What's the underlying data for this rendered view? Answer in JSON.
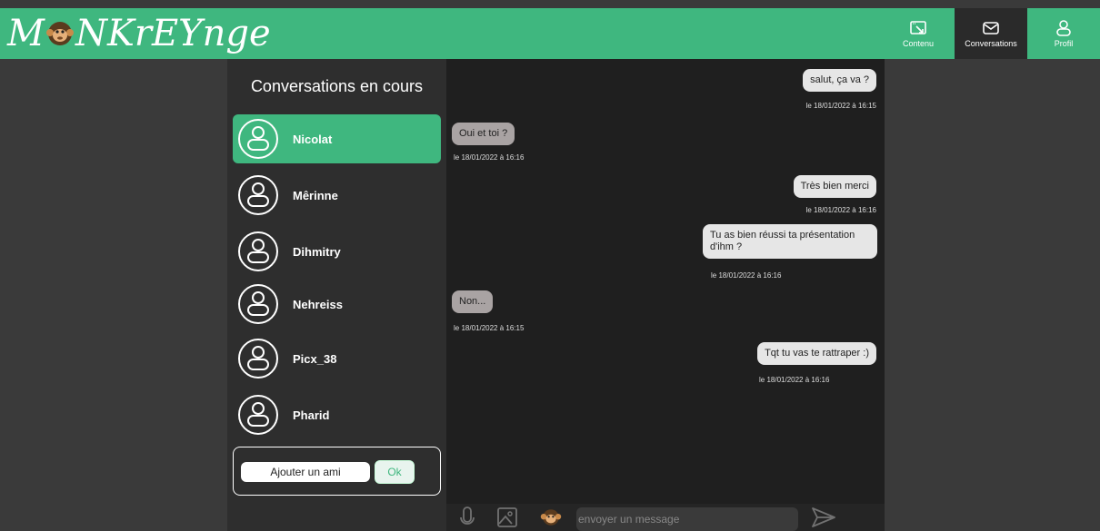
{
  "app": {
    "logo_pre": "M",
    "logo_post": "NKrEYnge"
  },
  "nav": {
    "items": [
      {
        "label": "Contenu",
        "icon": "image-icon",
        "active": false
      },
      {
        "label": "Conversations",
        "icon": "mail-icon",
        "active": true
      },
      {
        "label": "Profil",
        "icon": "user-icon",
        "active": false
      }
    ]
  },
  "sidebar": {
    "title": "Conversations en cours",
    "contacts": [
      {
        "name": "Nicolat",
        "active": true
      },
      {
        "name": "Mêrinne",
        "active": false
      },
      {
        "name": "Dihmitry",
        "active": false
      },
      {
        "name": "Nehreiss",
        "active": false
      },
      {
        "name": "Picx_38",
        "active": false
      },
      {
        "name": "Pharid",
        "active": false
      }
    ],
    "add_friend_label": "Ajouter un ami",
    "ok_label": "Ok"
  },
  "chat": {
    "messages": [
      {
        "text": "salut, ça va ?",
        "time": "le 18/01/2022 à 16:15",
        "from": "me"
      },
      {
        "text": "Oui et toi ?",
        "time": "le 18/01/2022 à 16:16",
        "from": "them"
      },
      {
        "text": "Très bien merci",
        "time": "le 18/01/2022 à 16:16",
        "from": "me"
      },
      {
        "text": "Tu as bien réussi ta présentation d'ihm ?",
        "time": "le 18/01/2022 à 16:16",
        "from": "me"
      },
      {
        "text": "Non...",
        "time": "le 18/01/2022 à 16:15",
        "from": "them"
      },
      {
        "text": "Tqt tu vas te rattraper :)",
        "time": "le 18/01/2022 à 16:16",
        "from": "me"
      }
    ],
    "composer_placeholder": "envoyer un message"
  },
  "colors": {
    "accent": "#3fb77f",
    "background": "#3a3a3a",
    "sidebar": "#2e2e2e",
    "chat": "#1f1f1f"
  }
}
